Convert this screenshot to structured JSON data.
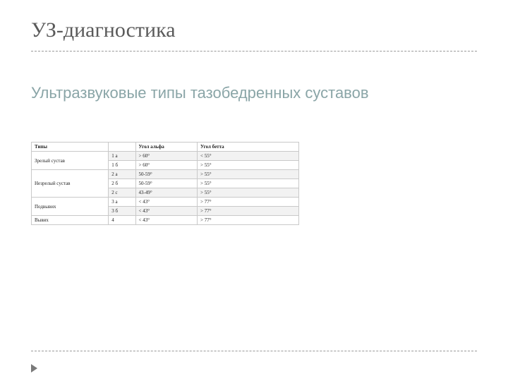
{
  "header": {
    "title": "УЗ-диагностика"
  },
  "content": {
    "subtitle": "Ультразвуковые типы тазобедренных суставов"
  },
  "table": {
    "headers": [
      "Типы",
      "",
      "Угол альфа",
      "Угол бетта"
    ],
    "rows": [
      {
        "group": "Зрелый сустав",
        "label": "1 а",
        "alpha": "> 60°",
        "beta": "< 55°"
      },
      {
        "group": "",
        "label": "1 б",
        "alpha": "> 60°",
        "beta": "> 55°"
      },
      {
        "group": "Незрелый сустав",
        "label": "2 а",
        "alpha": "50-59°",
        "beta": "> 55°"
      },
      {
        "group": "",
        "label": "2 б",
        "alpha": "50-59°",
        "beta": "> 55°"
      },
      {
        "group": "",
        "label": "2 с",
        "alpha": "43-49°",
        "beta": "> 55°"
      },
      {
        "group": "Подвывих",
        "label": "3 а",
        "alpha": "< 43°",
        "beta": "> 77°"
      },
      {
        "group": "",
        "label": "3 б",
        "alpha": "< 43°",
        "beta": "> 77°"
      },
      {
        "group": "Вывих",
        "label": "4",
        "alpha": "< 43°",
        "beta": "> 77°"
      }
    ]
  },
  "chart_data": {
    "type": "table",
    "title": "Ультразвуковые типы тазобедренных суставов",
    "columns": [
      "Типы",
      "",
      "Угол альфа",
      "Угол бетта"
    ],
    "data": [
      [
        "Зрелый сустав",
        "1 а",
        "> 60°",
        "< 55°"
      ],
      [
        "Зрелый сустав",
        "1 б",
        "> 60°",
        "> 55°"
      ],
      [
        "Незрелый сустав",
        "2 а",
        "50-59°",
        "> 55°"
      ],
      [
        "Незрелый сустав",
        "2 б",
        "50-59°",
        "> 55°"
      ],
      [
        "Незрелый сустав",
        "2 с",
        "43-49°",
        "> 55°"
      ],
      [
        "Подвывих",
        "3 а",
        "< 43°",
        "> 77°"
      ],
      [
        "Подвывих",
        "3 б",
        "< 43°",
        "> 77°"
      ],
      [
        "Вывих",
        "4",
        "< 43°",
        "> 77°"
      ]
    ]
  }
}
